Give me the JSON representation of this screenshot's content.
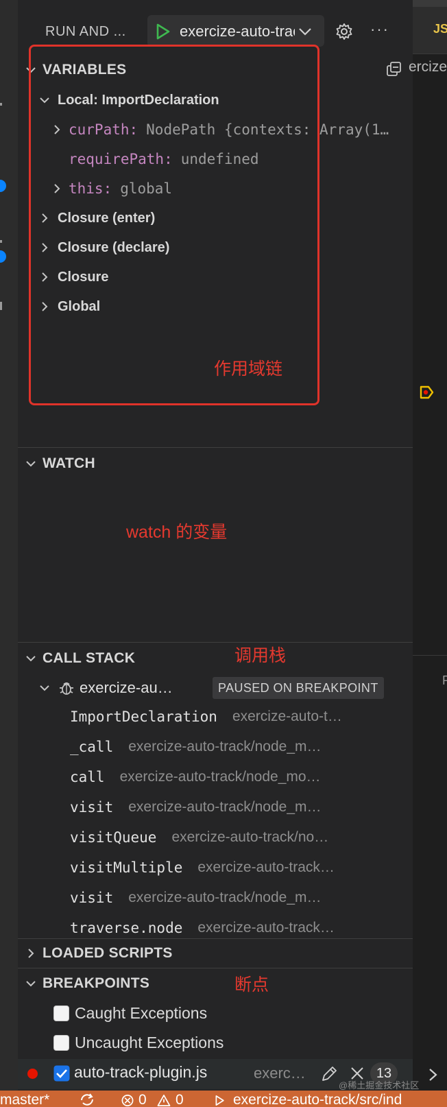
{
  "header": {
    "title": "RUN AND ...",
    "launch_config": "exercize-auto-track",
    "editor_tab": "JS",
    "editor_breadcrumb": "ercize",
    "editor_fragment": "P"
  },
  "variables": {
    "title": "VARIABLES",
    "scope": "Local: ImportDeclaration",
    "items": [
      {
        "name": "curPath:",
        "value": "NodePath {contexts: Array(1…"
      },
      {
        "name": "requirePath:",
        "value": "undefined"
      },
      {
        "name": "this:",
        "value": "global"
      }
    ],
    "closures": [
      "Closure (enter)",
      "Closure (declare)",
      "Closure",
      "Global"
    ]
  },
  "watch": {
    "title": "WATCH"
  },
  "call_stack": {
    "title": "CALL STACK",
    "session": "exercize-au…",
    "status": "PAUSED ON BREAKPOINT",
    "frames": [
      {
        "fn": "ImportDeclaration",
        "src": "exercize-auto-t…"
      },
      {
        "fn": "_call",
        "src": "exercize-auto-track/node_m…"
      },
      {
        "fn": "call",
        "src": "exercize-auto-track/node_mo…"
      },
      {
        "fn": "visit",
        "src": "exercize-auto-track/node_m…"
      },
      {
        "fn": "visitQueue",
        "src": "exercize-auto-track/no…"
      },
      {
        "fn": "visitMultiple",
        "src": "exercize-auto-track…"
      },
      {
        "fn": "visit",
        "src": "exercize-auto-track/node_m…"
      },
      {
        "fn": "traverse.node",
        "src": "exercize-auto-track…"
      }
    ]
  },
  "loaded_scripts": {
    "title": "LOADED SCRIPTS"
  },
  "breakpoints": {
    "title": "BREAKPOINTS",
    "caught": "Caught Exceptions",
    "uncaught": "Uncaught Exceptions",
    "file": "auto-track-plugin.js",
    "path": "exerc…",
    "line": "13"
  },
  "annotations": {
    "scope_chain": "作用域链",
    "watch_vars": "watch 的变量",
    "call_stack": "调用栈",
    "breakpoints": "断点"
  },
  "status_bar": {
    "branch": "master*",
    "errors": "0",
    "warnings": "0",
    "launch_path": "exercize-auto-track/src/ind"
  },
  "watermark": "@稀土掘金技术社区",
  "colors": {
    "accent_red": "#e5392f",
    "variable_name": "#c586c0",
    "status_bar": "#cc6633",
    "play_green": "#3fb950",
    "breakpoint_red": "#e51400",
    "checkbox_blue": "#1a73e8"
  }
}
